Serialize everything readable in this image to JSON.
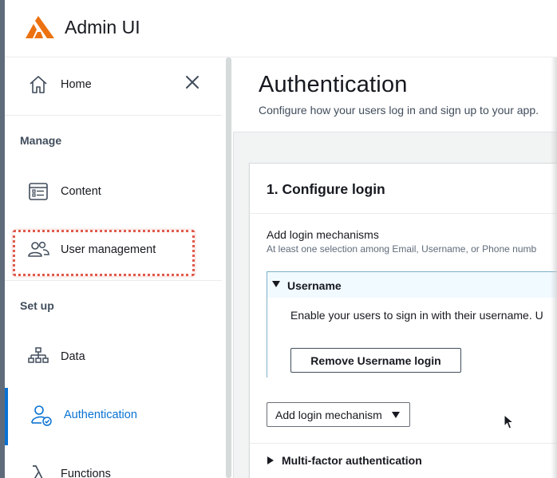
{
  "app": {
    "title": "Admin UI",
    "brand_color": "#ec7211",
    "accent_color": "#0972d3"
  },
  "sidebar": {
    "home_label": "Home",
    "close_icon": "close-icon",
    "manage_header": "Manage",
    "setup_header": "Set up",
    "items": [
      {
        "label": "Content",
        "icon": "content-icon"
      },
      {
        "label": "User management",
        "icon": "users-icon"
      },
      {
        "label": "Data",
        "icon": "data-icon"
      },
      {
        "label": "Authentication",
        "icon": "authentication-icon",
        "active": true
      },
      {
        "label": "Functions",
        "icon": "lambda-icon"
      }
    ]
  },
  "main": {
    "title": "Authentication",
    "description": "Configure how your users log in and sign up to your app.",
    "card": {
      "title": "1. Configure login",
      "field_label": "Add login mechanisms",
      "field_description": "At least one selection among Email, Username, or Phone numb",
      "username_panel": {
        "title": "Username",
        "text": "Enable your users to sign in with their username. U",
        "remove_button": "Remove Username login"
      },
      "add_mechanism_button": "Add login mechanism",
      "mfa_label": "Multi-factor authentication"
    }
  }
}
